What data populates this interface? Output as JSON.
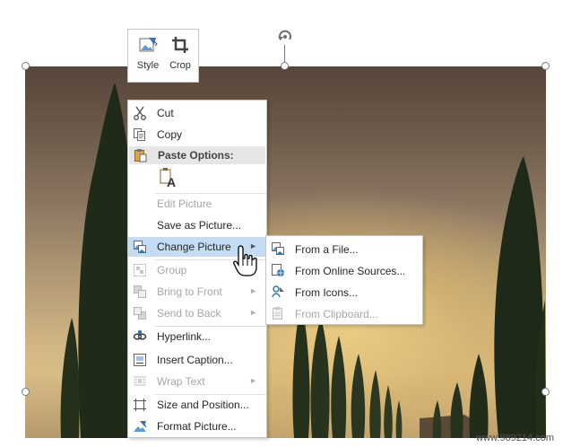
{
  "mini_toolbar": {
    "style_label": "Style",
    "crop_label": "Crop"
  },
  "context_menu": {
    "items": [
      {
        "label": "Cut",
        "icon": "scissors-icon",
        "enabled": true
      },
      {
        "label": "Copy",
        "icon": "copy-icon",
        "enabled": true
      },
      {
        "label": "Paste Options:",
        "icon": "paste-icon",
        "enabled": true
      },
      {
        "label": "A",
        "icon": "paste-keep-text-icon",
        "enabled": true
      },
      {
        "label": "Edit Picture",
        "icon": "",
        "enabled": false
      },
      {
        "label": "Save as Picture...",
        "icon": "",
        "enabled": true
      },
      {
        "label": "Change Picture",
        "icon": "change-picture-icon",
        "enabled": true,
        "submenu": true,
        "highlighted": true
      },
      {
        "label": "Group",
        "icon": "group-icon",
        "enabled": false
      },
      {
        "label": "Bring to Front",
        "icon": "bring-to-front-icon",
        "enabled": false,
        "submenu": true
      },
      {
        "label": "Send to Back",
        "icon": "send-to-back-icon",
        "enabled": false,
        "submenu": true
      },
      {
        "label": "Hyperlink...",
        "icon": "hyperlink-icon",
        "enabled": true
      },
      {
        "label": "Insert Caption...",
        "icon": "insert-caption-icon",
        "enabled": true
      },
      {
        "label": "Wrap Text",
        "icon": "wrap-text-icon",
        "enabled": false,
        "submenu": true
      },
      {
        "label": "Size and Position...",
        "icon": "size-position-icon",
        "enabled": true
      },
      {
        "label": "Format Picture...",
        "icon": "format-picture-icon",
        "enabled": true
      }
    ]
  },
  "change_picture_submenu": {
    "items": [
      {
        "label": "From a File...",
        "icon": "from-file-icon",
        "enabled": true
      },
      {
        "label": "From Online Sources...",
        "icon": "online-sources-icon",
        "enabled": true
      },
      {
        "label": "From Icons...",
        "icon": "icons-icon",
        "enabled": true
      },
      {
        "label": "From Clipboard...",
        "icon": "clipboard-icon",
        "enabled": false
      }
    ]
  },
  "watermark": "www.989214.com",
  "colors": {
    "highlight": "#c5ddf2",
    "disabled_text": "#a6a6a6",
    "icon_blue": "#2e75b6"
  }
}
